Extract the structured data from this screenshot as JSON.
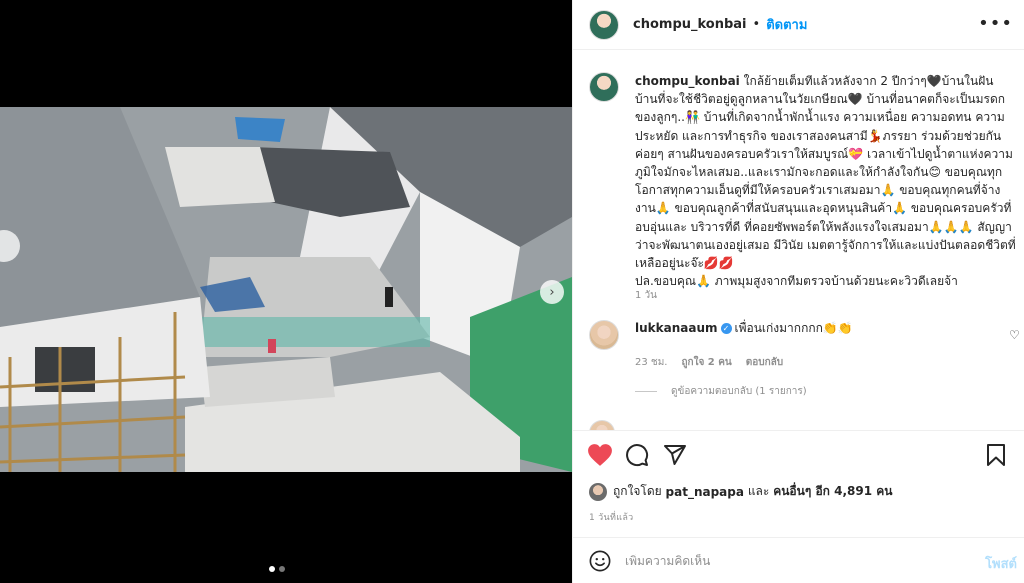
{
  "header": {
    "username": "chompu_konbai",
    "separator": "•",
    "follow_label": "ติดตาม",
    "more_label": "•••"
  },
  "caption": {
    "username": "chompu_konbai",
    "text": " ใกล้ย้ายเต็มทีแล้วหลังจาก 2 ปีกว่าๆ🖤บ้านในฝัน บ้านที่จะใช้ชีวิตอยู่ดูลูกหลานในวัยเกษียณ🖤 บ้านที่อนาคตก็จะเป็นมรดกของลูกๆ..👫 บ้านที่เกิดจากน้ำพักน้ำแรง ความเหนื่อย ความอดทน ความประหยัด และการทำธุรกิจ ของเราสองคนสามี💃ภรรยา ร่วมด้วยช่วยกันค่อยๆ สานฝันของครอบครัวเราให้สมบูรณ์💝 เวลาเข้าไปดูน้ำตาแห่งความภูมิใจมักจะไหลเสมอ..และเรามักจะกอดและให้กำลังใจกัน😊 ขอบคุณทุกโอกาสทุกความเอ็นดูที่มีให้ครอบครัวเราเสมอมา🙏 ขอบคุณทุกคนที่จ้างงาน🙏 ขอบคุณลูกค้าที่สนับสนุนและอุดหนุนสินค้า🙏 ขอบคุณครอบครัวที่อบอุ่นและ บริวารที่ดี ที่คอยซัพพอร์ตให้พลังแรงใจเสมอมา🙏🙏🙏 สัญญาว่าจะพัฒนาตนเองอยู่เสมอ มีวินัย เมตตารู้จักการให้และแบ่งปันตลอดชีวิตที่เหลืออยู่นะจ๊ะ💋💋\nปล.ขอบคุณ🙏 ภาพมุมสูงจากทีมตรวจบ้านด้วยนะคะวิวดีเลยจ้า",
    "age": "1 วัน"
  },
  "comment1": {
    "username": "lukkanaaum",
    "verified_mark": "✓",
    "text": "เพื่อนเก่งมากกกก👏👏",
    "age": "23 ชม.",
    "likes": "ถูกใจ 2 คน",
    "reply_label": "ตอบกลับ",
    "heart": "♡",
    "view_replies": "ดูข้อความตอบกลับ (1 รายการ)"
  },
  "likes": {
    "prefix": "ถูกใจโดย",
    "user": "pat_napapa",
    "and": "และ",
    "others": "คนอื่นๆ อีก 4,891 คน"
  },
  "post_age": "1 วันที่แล้ว",
  "composer": {
    "placeholder": "เพิ่มความคิดเห็น",
    "post_label": "โพสต์"
  },
  "icons": {
    "like": "heart-filled-icon",
    "comment": "comment-icon",
    "share": "share-icon",
    "save": "bookmark-icon",
    "emoji": "emoji-icon",
    "next": "chevron-right-icon"
  },
  "colors": {
    "accent": "#0095f6",
    "like": "#ed4956",
    "post_disabled": "#b2dffc"
  },
  "carousel": {
    "slide": 1,
    "total": 2,
    "next_glyph": "›"
  }
}
